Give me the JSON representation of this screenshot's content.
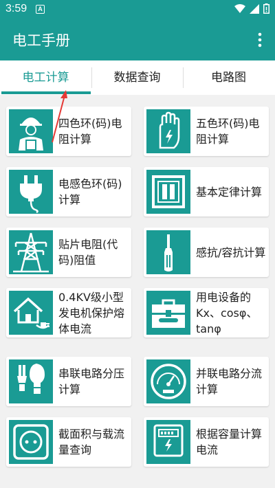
{
  "status": {
    "time": "3:59",
    "a_icon": "A"
  },
  "app": {
    "title": "电工手册"
  },
  "tabs": [
    {
      "label": "电工计算",
      "active": true
    },
    {
      "label": "数据查询",
      "active": false
    },
    {
      "label": "电路图",
      "active": false
    }
  ],
  "cards": [
    {
      "label": "四色环(码)电阻计算",
      "icon": "worker-icon"
    },
    {
      "label": "五色环(码)电阻计算",
      "icon": "glove-icon"
    },
    {
      "label": "电感色环(码)计算",
      "icon": "plug-icon"
    },
    {
      "label": "基本定律计算",
      "icon": "switch-icon"
    },
    {
      "label": "贴片电阻(代码)阻值",
      "icon": "tower-icon"
    },
    {
      "label": "感抗/容抗计算",
      "icon": "screwdriver-icon"
    },
    {
      "label": "0.4KV级小型发电机保护熔体电流",
      "icon": "house-plug-icon"
    },
    {
      "label": "用电设备的Kx、cosφ、tanφ",
      "icon": "toolbox-icon"
    },
    {
      "label": "串联电路分压计算",
      "icon": "bulb-icon"
    },
    {
      "label": "并联电路分流计算",
      "icon": "gauge-icon"
    },
    {
      "label": "截面积与载流量查询",
      "icon": "socket-icon"
    },
    {
      "label": "根据容量计算电流",
      "icon": "meter-icon"
    }
  ],
  "colors": {
    "primary": "#1a9b94",
    "annotation_arrow": "#e53935"
  }
}
